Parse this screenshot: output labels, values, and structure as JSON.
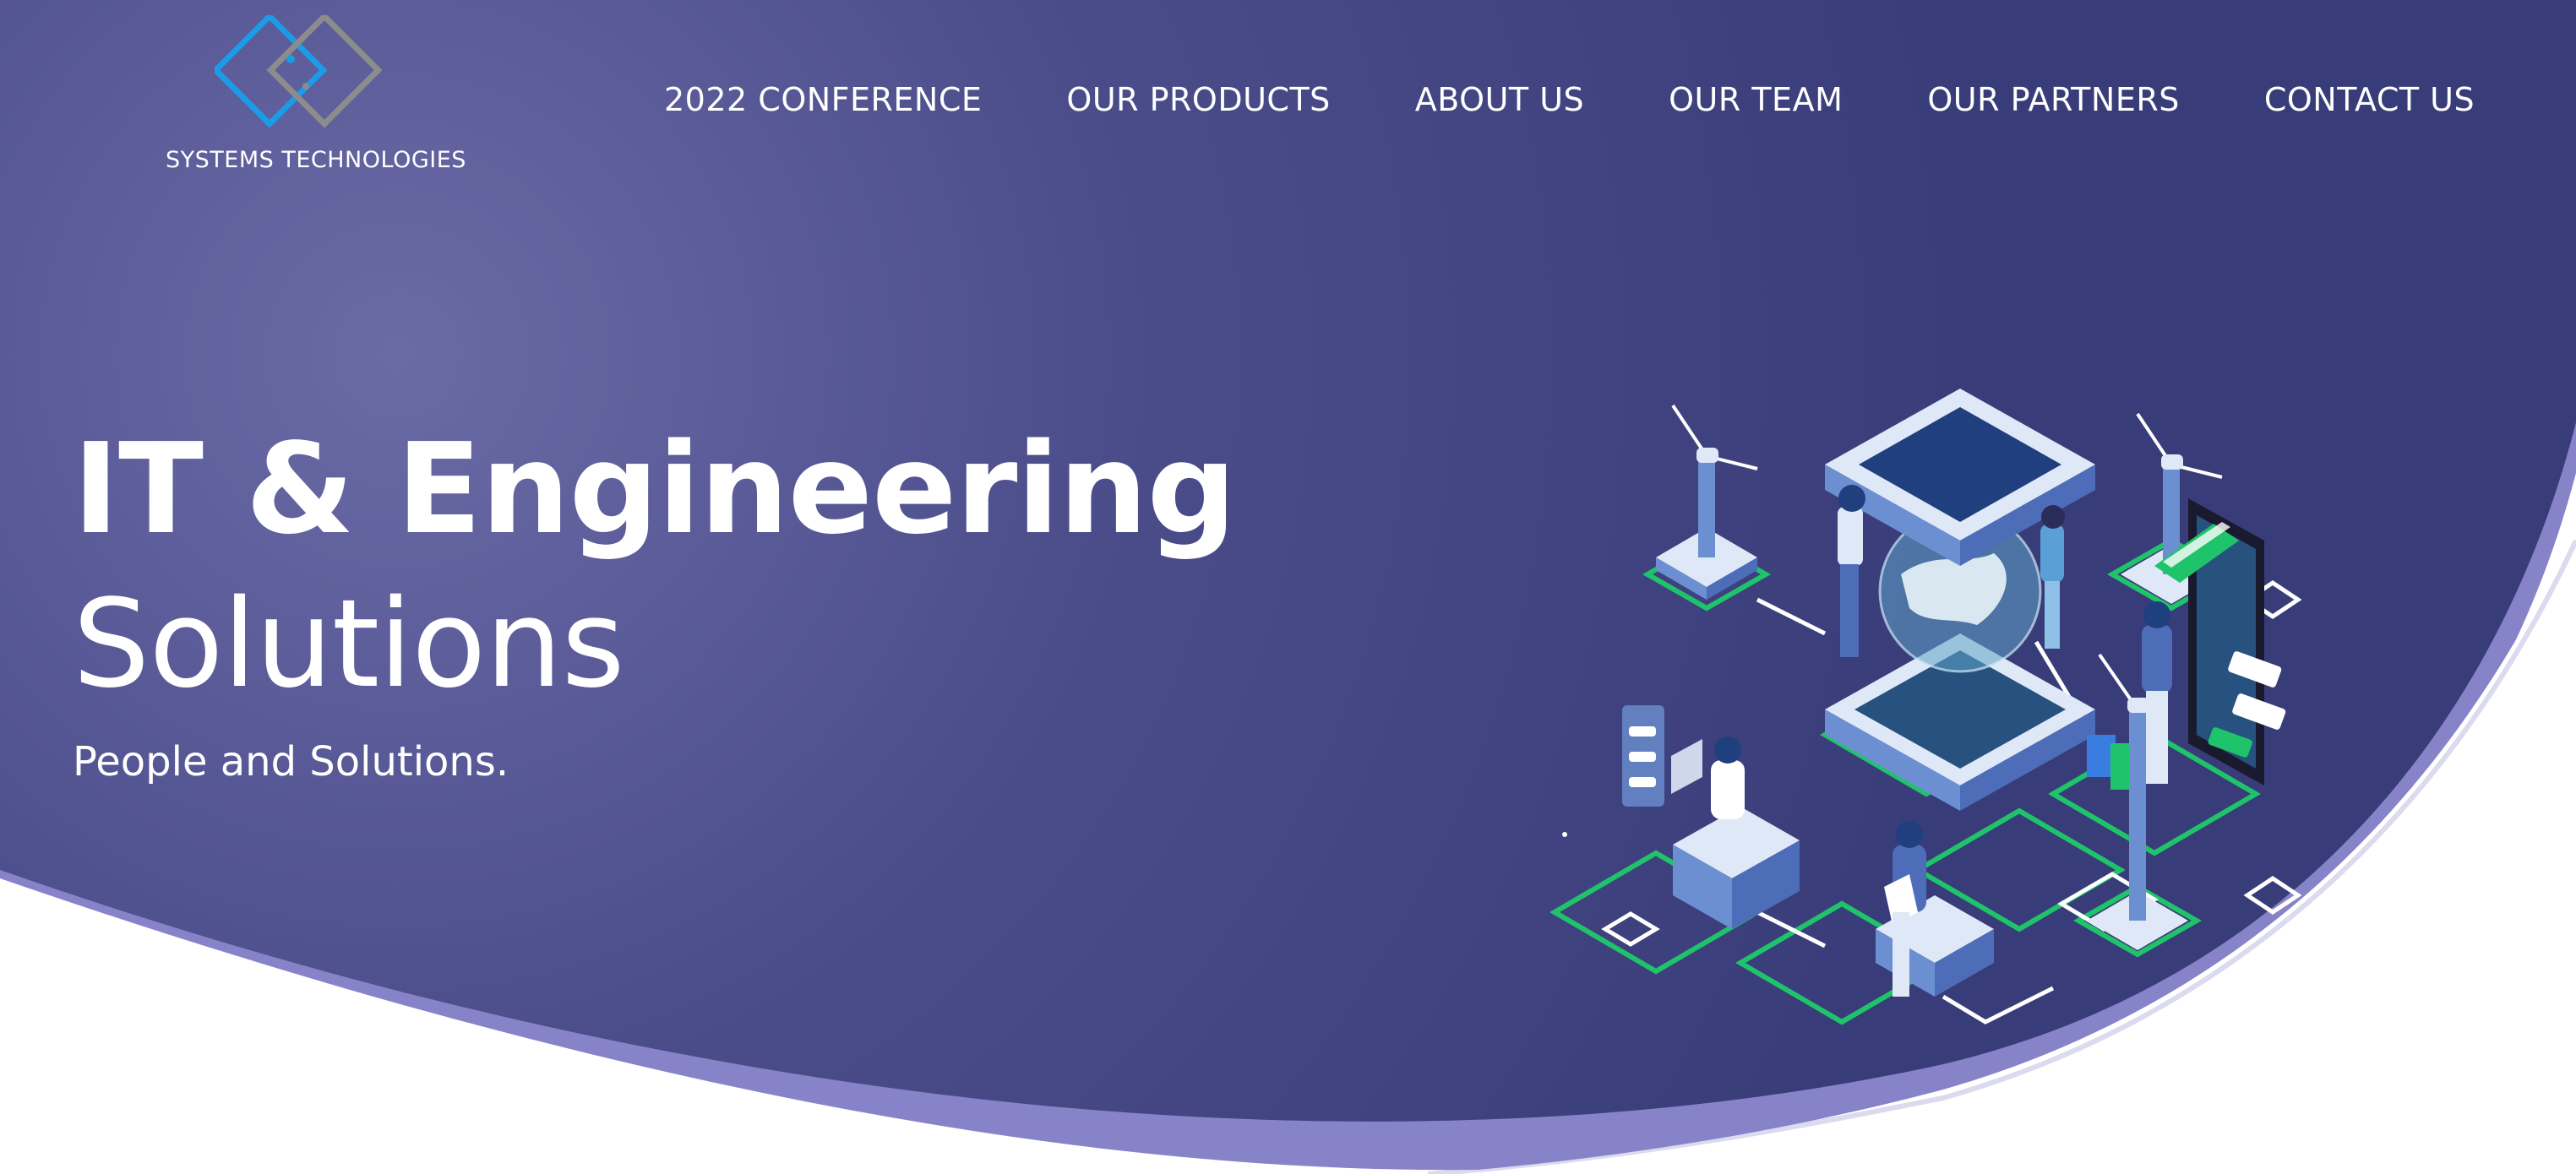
{
  "brand": {
    "name": "SYSTEMS TECHNOLOGIES",
    "logo_icon": "interlocking-diamonds-logo",
    "colors": {
      "logo_blue": "#1c9be6",
      "logo_gray": "#8c8c8c"
    }
  },
  "nav": {
    "items": [
      {
        "label": "2022 CONFERENCE"
      },
      {
        "label": "OUR PRODUCTS"
      },
      {
        "label": "ABOUT US"
      },
      {
        "label": "OUR TEAM"
      },
      {
        "label": "OUR PARTNERS"
      },
      {
        "label": "CONTACT US"
      }
    ]
  },
  "hero": {
    "title_line_1": "IT & Engineering",
    "title_line_2": "Solutions",
    "subtitle": "People and Solutions.",
    "illustration": "isometric-tech-platform-illustration",
    "colors": {
      "background_dark": "#3b3f7d",
      "background_light": "#6a6aa6",
      "curve_accent": "#8783c8",
      "accent_green": "#1fc46a"
    }
  }
}
